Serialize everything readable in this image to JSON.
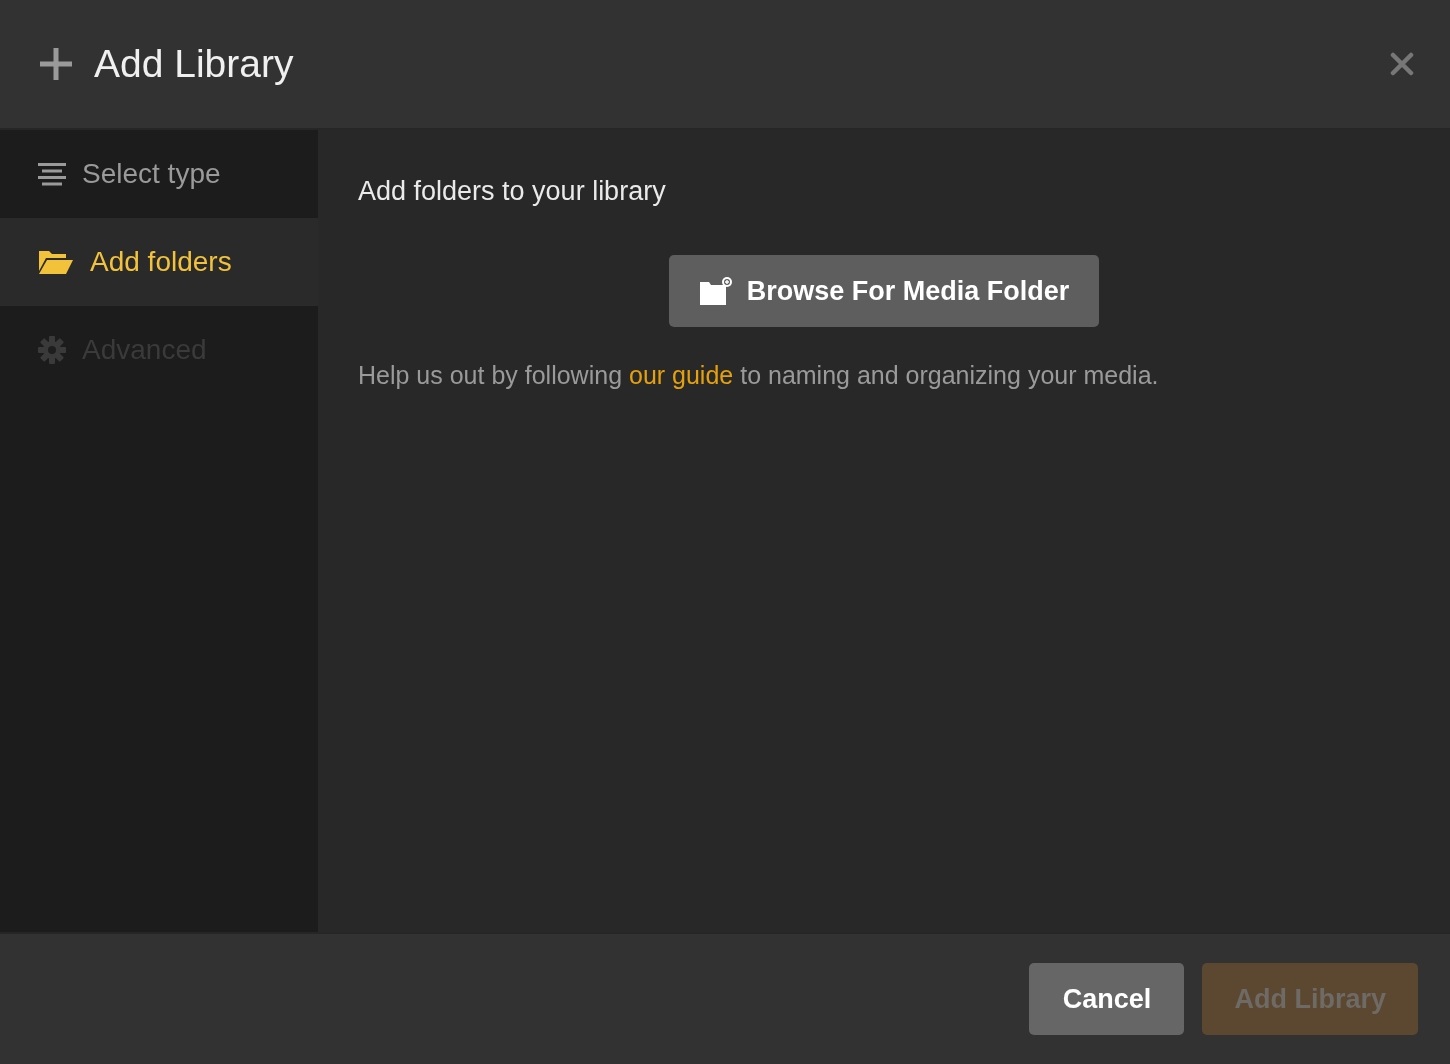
{
  "dialog": {
    "title": "Add Library"
  },
  "steps": [
    {
      "label": "Select type",
      "kind": "list",
      "selected": false,
      "disabled": false
    },
    {
      "label": "Add folders",
      "kind": "folder",
      "selected": true,
      "disabled": false
    },
    {
      "label": "Advanced",
      "kind": "gear",
      "selected": false,
      "disabled": true
    }
  ],
  "content": {
    "heading": "Add folders to your library",
    "browse_button": "Browse For Media Folder",
    "help_before": "Help us out by following",
    "help_link": "our guide",
    "help_after": "to naming and organizing your media."
  },
  "buttons": [
    {
      "label": "Cancel",
      "kind": "secondary",
      "disabled": false
    },
    {
      "label": "Add Library",
      "kind": "primary",
      "disabled": true
    }
  ]
}
